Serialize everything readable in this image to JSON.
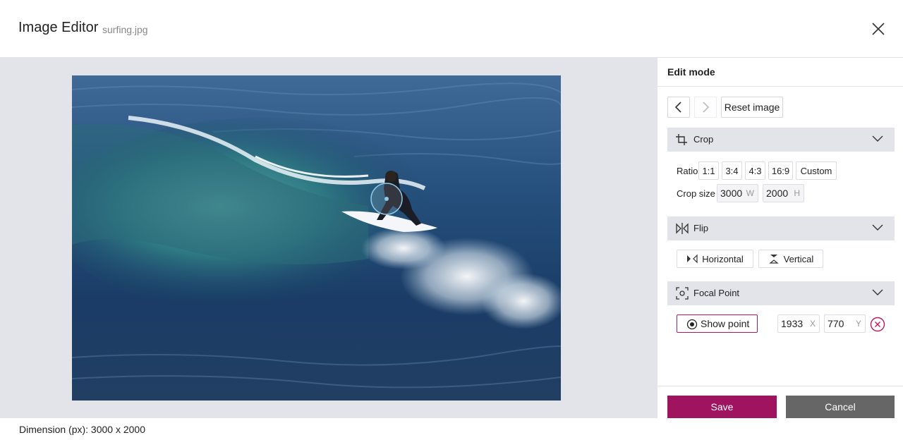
{
  "header": {
    "title": "Image Editor",
    "filename": "surfing.jpg",
    "close_icon": "close-icon"
  },
  "image": {
    "description_icon": "surfing-photo",
    "focal_marker_icon": "focal-point-marker"
  },
  "footer": {
    "dimension_text": "Dimension (px): 3000 x 2000"
  },
  "panel": {
    "title": "Edit mode",
    "history": {
      "undo_icon": "chevron-left-icon",
      "redo_icon": "chevron-right-icon",
      "reset_label": "Reset image"
    },
    "crop": {
      "label": "Crop",
      "icon": "crop-icon",
      "ratio_label": "Ratio",
      "ratios": [
        "1:1",
        "3:4",
        "4:3",
        "16:9",
        "Custom"
      ],
      "size_label": "Crop size",
      "width": "3000",
      "width_unit": "W",
      "height": "2000",
      "height_unit": "H"
    },
    "flip": {
      "label": "Flip",
      "icon": "flip-icon",
      "horizontal_label": "Horizontal",
      "vertical_label": "Vertical"
    },
    "focal": {
      "label": "Focal Point",
      "icon": "focus-icon",
      "show_label": "Show point",
      "x": "1933",
      "x_unit": "X",
      "y": "770",
      "y_unit": "Y"
    },
    "actions": {
      "save_label": "Save",
      "cancel_label": "Cancel"
    }
  },
  "colors": {
    "accent": "#a0135f",
    "cancel": "#666666",
    "section_bg": "#e3e3ea"
  }
}
